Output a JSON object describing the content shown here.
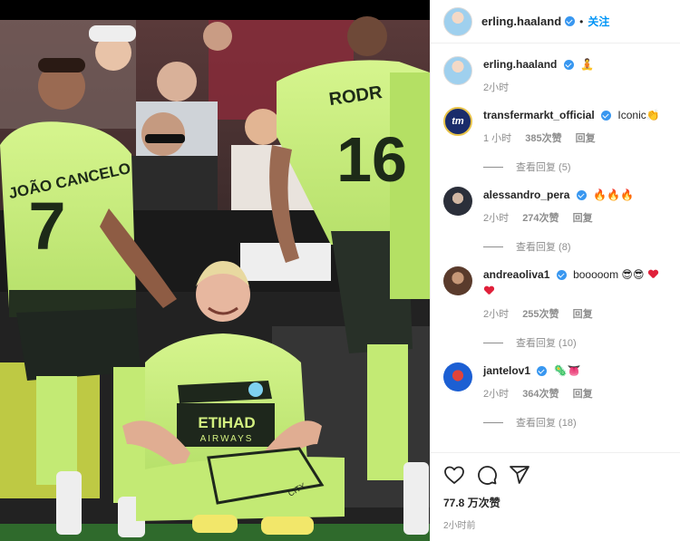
{
  "post": {
    "author": "erling.haaland",
    "follow_label": "关注",
    "separator": "•",
    "caption_emoji": "🧘",
    "caption_time": "2小时",
    "likes": "77.8 万次赞",
    "posted_time": "2小时前"
  },
  "photo": {
    "shirt_left_name": "JOÃO CANCELO",
    "shirt_left_number": "7",
    "shirt_right_name": "RODR",
    "shirt_right_number": "16",
    "sponsor_line1": "ETIHAD",
    "sponsor_line2": "AIRWAYS",
    "sock_text": "CITY"
  },
  "comments": [
    {
      "user": "transfermarkt_official",
      "avatar_text": "tm",
      "text": "Iconic👏",
      "time": "1 小时",
      "likes": "385次赞",
      "reply": "回复",
      "view_replies": "查看回复 (5)"
    },
    {
      "user": "alessandro_pera",
      "text": "🔥🔥🔥",
      "time": "2小时",
      "likes": "274次赞",
      "reply": "回复",
      "view_replies": "查看回复 (8)"
    },
    {
      "user": "andreaoliva1",
      "text": "booooom 😎😎",
      "time": "2小时",
      "likes": "255次赞",
      "reply": "回复",
      "view_replies": "查看回复 (10)"
    },
    {
      "user": "jantelov1",
      "text": "🦠👅",
      "time": "2小时",
      "likes": "364次赞",
      "reply": "回复",
      "view_replies": "查看回复 (18)"
    }
  ],
  "icons": {
    "like": "heart-outline-icon",
    "comment": "comment-bubble-icon",
    "share": "paper-plane-icon"
  },
  "colors": {
    "link_blue": "#0095f6",
    "verified_blue": "#3897f0",
    "meta_gray": "#8e8e8e",
    "kit_green": "#c9f27a"
  }
}
